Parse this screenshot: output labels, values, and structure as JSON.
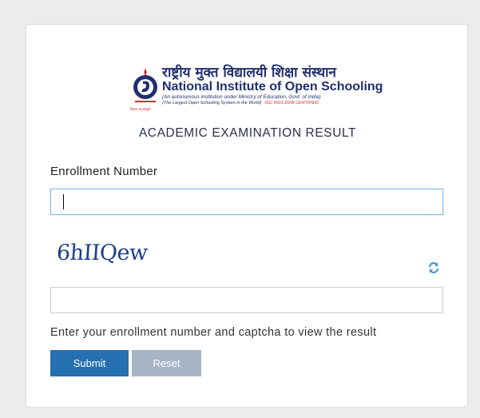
{
  "logo": {
    "hindi": "राष्ट्रीय मुक्त विद्यालयी शिक्षा संस्थान",
    "english_prefix": "National Institute of ",
    "english_highlight": "Open Schooling",
    "subtitle": "(An autonomous institution under Ministry of Education, Govt. of India)",
    "tagline": "(The Largest Open Schooling System in the World)",
    "iso": "ISO 9001:2008 CERTIFIED",
    "emblem_tag": "विद्यया अमृतमश्नुते"
  },
  "page": {
    "title": "ACADEMIC EXAMINATION RESULT"
  },
  "form": {
    "enrollment_label": "Enrollment Number",
    "enrollment_value": "",
    "captcha_text": "6hIIQew",
    "captcha_value": "",
    "help_text": "Enter your enrollment number and captcha to view the result",
    "submit_label": "Submit",
    "reset_label": "Reset"
  },
  "colors": {
    "primary": "#2470b0",
    "reset": "#a6b4c6",
    "brand": "#1f2f6d",
    "accent": "#d12a2a"
  }
}
